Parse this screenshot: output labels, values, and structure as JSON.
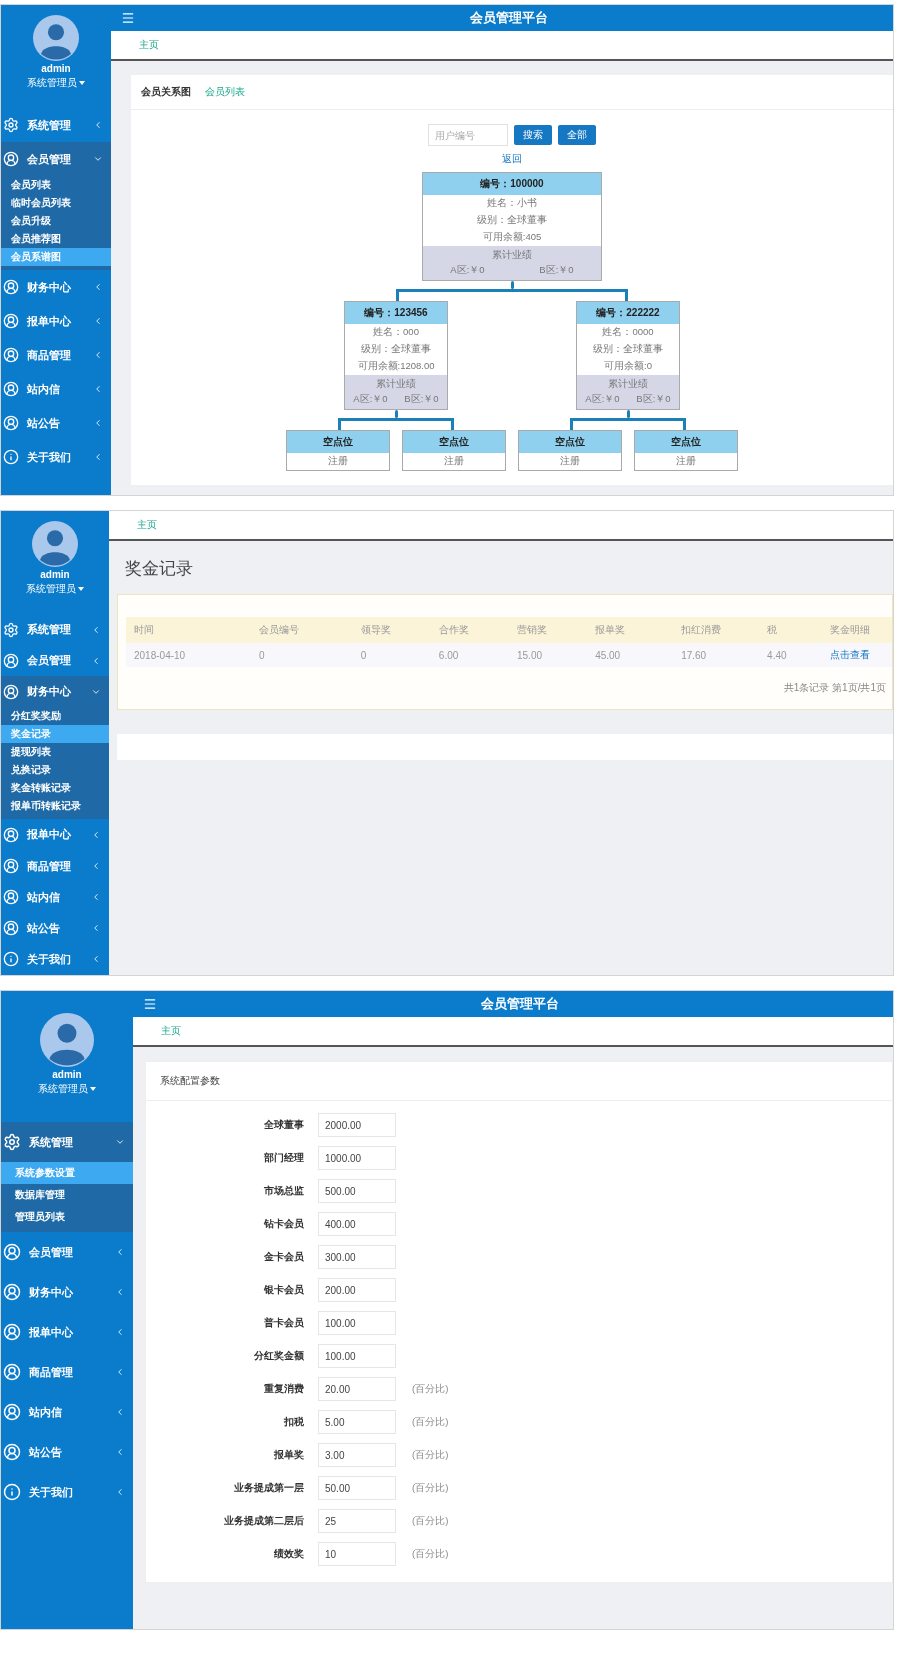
{
  "panels": [
    {
      "kind": "tree",
      "header": {
        "title": "会员管理平台"
      },
      "user": {
        "name": "admin",
        "role": "系统管理员"
      },
      "sidebar": [
        {
          "label": "系统管理",
          "kind": "settings",
          "expanded": false
        },
        {
          "label": "会员管理",
          "kind": "user",
          "expanded": true,
          "children": [
            {
              "label": "会员列表",
              "selected": false
            },
            {
              "label": "临时会员列表",
              "selected": false
            },
            {
              "label": "会员升级",
              "selected": false
            },
            {
              "label": "会员推荐图",
              "selected": false
            },
            {
              "label": "会员系谱图",
              "selected": true
            }
          ]
        },
        {
          "label": "财务中心",
          "kind": "user",
          "expanded": false
        },
        {
          "label": "报单中心",
          "kind": "user",
          "expanded": false
        },
        {
          "label": "商品管理",
          "kind": "user",
          "expanded": false
        },
        {
          "label": "站内信",
          "kind": "user",
          "expanded": false
        },
        {
          "label": "站公告",
          "kind": "user",
          "expanded": false
        },
        {
          "label": "关于我们",
          "kind": "about",
          "expanded": false
        }
      ],
      "breadcrumb": "主页",
      "tabs": [
        {
          "label": "会员关系图",
          "selected": true
        },
        {
          "label": "会员列表",
          "selected": false
        }
      ],
      "search": {
        "placeholder": "用户编号"
      },
      "buttons": [
        "搜索",
        "全部"
      ],
      "back_link": "返回",
      "tree": {
        "kind": "member",
        "number": "编号：100000",
        "name": "姓名：小书",
        "level": "级别：全球董事",
        "balance": "可用余额:405",
        "total": "累计业绩",
        "zone_a": "A区:￥0",
        "zone_b": "B区:￥0",
        "children": [
          {
            "kind": "member",
            "number": "编号：123456",
            "name": "姓名：000",
            "level": "级别：全球董事",
            "balance": "可用余额:1208.00",
            "total": "累计业绩",
            "zone_a": "A区:￥0",
            "zone_b": "B区:￥0",
            "children": [
              {
                "kind": "empty",
                "title": "空点位",
                "action": "注册"
              },
              {
                "kind": "empty",
                "title": "空点位",
                "action": "注册"
              }
            ]
          },
          {
            "kind": "member",
            "number": "编号：222222",
            "name": "姓名：0000",
            "level": "级别：全球董事",
            "balance": "可用余额:0",
            "total": "累计业绩",
            "zone_a": "A区:￥0",
            "zone_b": "B区:￥0",
            "children": [
              {
                "kind": "empty",
                "title": "空点位",
                "action": "注册"
              },
              {
                "kind": "empty",
                "title": "空点位",
                "action": "注册"
              }
            ]
          }
        ]
      }
    },
    {
      "kind": "table",
      "user": {
        "name": "admin",
        "role": "系统管理员"
      },
      "sidebar": [
        {
          "label": "系统管理",
          "kind": "settings",
          "expanded": false
        },
        {
          "label": "会员管理",
          "kind": "user",
          "expanded": false
        },
        {
          "label": "财务中心",
          "kind": "user",
          "expanded": true,
          "children": [
            {
              "label": "分红奖奖励",
              "selected": false
            },
            {
              "label": "奖金记录",
              "selected": true
            },
            {
              "label": "提现列表",
              "selected": false
            },
            {
              "label": "兑换记录",
              "selected": false
            },
            {
              "label": "奖金转账记录",
              "selected": false
            },
            {
              "label": "报单币转账记录",
              "selected": false
            }
          ]
        },
        {
          "label": "报单中心",
          "kind": "user",
          "expanded": false
        },
        {
          "label": "商品管理",
          "kind": "user",
          "expanded": false
        },
        {
          "label": "站内信",
          "kind": "user",
          "expanded": false
        },
        {
          "label": "站公告",
          "kind": "user",
          "expanded": false
        },
        {
          "label": "关于我们",
          "kind": "about",
          "expanded": false
        }
      ],
      "breadcrumb": "主页",
      "title": "奖金记录",
      "columns": [
        "时间",
        "会员编号",
        "领导奖",
        "合作奖",
        "营销奖",
        "报单奖",
        "扣红消费",
        "税",
        "奖金明细"
      ],
      "rows": [
        [
          "2018-04-10",
          "0",
          "0",
          "6.00",
          "15.00",
          "45.00",
          "17.60",
          "4.40",
          "点击查看"
        ]
      ],
      "pagination": "共1条记录 第1页/共1页"
    },
    {
      "kind": "form",
      "header": {
        "title": "会员管理平台"
      },
      "user": {
        "name": "admin",
        "role": "系统管理员"
      },
      "sidebar": [
        {
          "label": "系统管理",
          "kind": "settings",
          "expanded": true,
          "children": [
            {
              "label": "系统参数设置",
              "selected": true
            },
            {
              "label": "数据库管理",
              "selected": false
            },
            {
              "label": "管理员列表",
              "selected": false
            }
          ]
        },
        {
          "label": "会员管理",
          "kind": "user",
          "expanded": false
        },
        {
          "label": "财务中心",
          "kind": "user",
          "expanded": false
        },
        {
          "label": "报单中心",
          "kind": "user",
          "expanded": false
        },
        {
          "label": "商品管理",
          "kind": "user",
          "expanded": false
        },
        {
          "label": "站内信",
          "kind": "user",
          "expanded": false
        },
        {
          "label": "站公告",
          "kind": "user",
          "expanded": false
        },
        {
          "label": "关于我们",
          "kind": "about",
          "expanded": false
        }
      ],
      "breadcrumb": "主页",
      "title": "系统配置参数",
      "fields": [
        {
          "label": "全球董事",
          "value": "2000.00"
        },
        {
          "label": "部门经理",
          "value": "1000.00"
        },
        {
          "label": "市场总监",
          "value": "500.00"
        },
        {
          "label": "钻卡会员",
          "value": "400.00"
        },
        {
          "label": "金卡会员",
          "value": "300.00"
        },
        {
          "label": "银卡会员",
          "value": "200.00"
        },
        {
          "label": "普卡会员",
          "value": "100.00"
        },
        {
          "label": "分红奖金额",
          "value": "100.00"
        },
        {
          "label": "重复消费",
          "value": "20.00",
          "suffix": "(百分比)"
        },
        {
          "label": "扣税",
          "value": "5.00",
          "suffix": "(百分比)"
        },
        {
          "label": "报单奖",
          "value": "3.00",
          "suffix": "(百分比)"
        },
        {
          "label": "业务提成第一层",
          "value": "50.00",
          "suffix": "(百分比)"
        },
        {
          "label": "业务提成第二层后",
          "value": "25",
          "suffix": "(百分比)"
        },
        {
          "label": "绩效奖",
          "value": "10",
          "suffix": "(百分比)"
        }
      ]
    }
  ]
}
